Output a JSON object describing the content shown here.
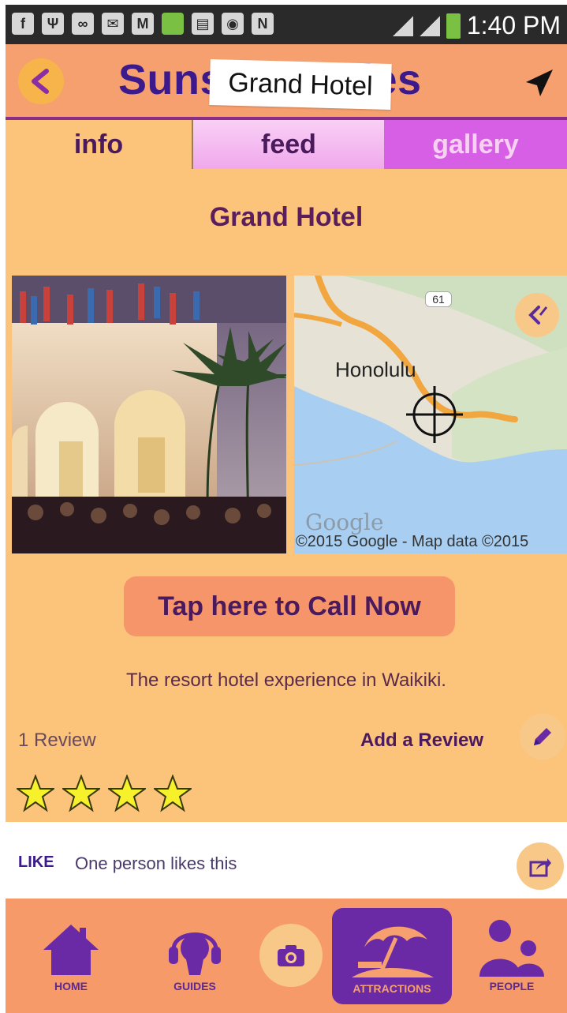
{
  "status_bar": {
    "time": "1:40 PM",
    "icons": [
      "facebook-icon",
      "usb-icon",
      "link-icon",
      "message-icon",
      "mail-icon",
      "battery-app-icon",
      "document-icon",
      "eye-icon",
      "nfc-icon",
      "wifi-icon",
      "signal-icon",
      "battery-icon"
    ]
  },
  "header": {
    "app_title": "Sunset Guides",
    "tooltip": "Grand Hotel"
  },
  "tabs": [
    {
      "label": "info",
      "active": true
    },
    {
      "label": "feed",
      "active": false
    },
    {
      "label": "gallery",
      "active": false
    }
  ],
  "hotel": {
    "name": "Grand Hotel",
    "description": "The resort hotel experience in Waikiki.",
    "call_button": "Tap here to Call Now"
  },
  "map": {
    "city_label": "Honolulu",
    "route_badge": "61",
    "copyright": "©2015 Google - Map data ©2015",
    "watermark": "Google"
  },
  "reviews": {
    "count_label": "1 Review",
    "add_label": "Add a Review",
    "rating": 4,
    "max_rating": 4
  },
  "like_bar": {
    "label": "LIKE",
    "text": "One person likes this"
  },
  "bottom_nav": [
    {
      "label": "HOME",
      "icon": "home-icon"
    },
    {
      "label": "GUIDES",
      "icon": "headphones-icon"
    },
    {
      "label": "",
      "icon": "camera-icon"
    },
    {
      "label": "ATTRACTIONS",
      "icon": "beach-umbrella-icon",
      "active": true
    },
    {
      "label": "PEOPLE",
      "icon": "people-icon"
    }
  ],
  "colors": {
    "header_bg": "#f7a06f",
    "page_bg": "#fcc37b",
    "title_purple": "#3d1a8b",
    "accent_purple": "#6a2aa5",
    "tab_gallery": "#d65fe6"
  }
}
